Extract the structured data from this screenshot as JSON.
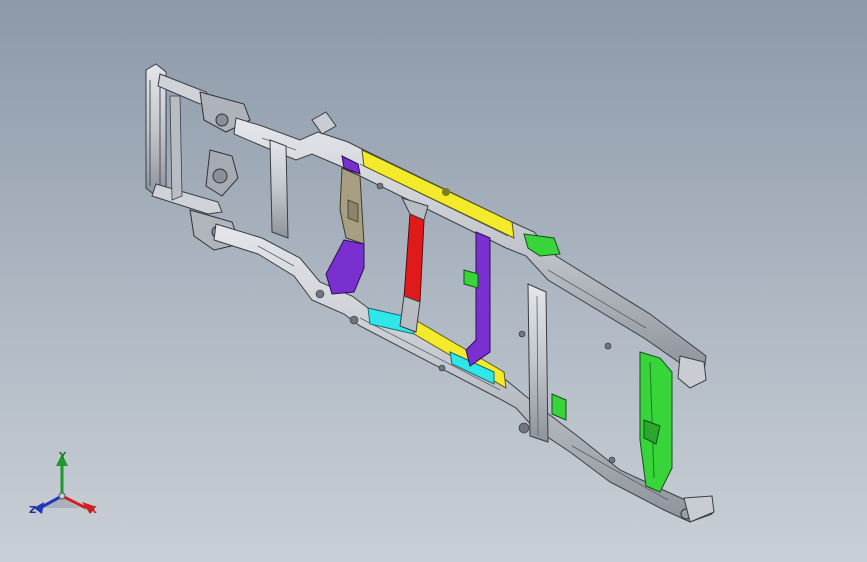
{
  "viewport": {
    "background_top": "#8d99a8",
    "background_bottom": "#c9cfd6"
  },
  "model": {
    "kind": "vehicle ladder frame chassis assembly",
    "colors": {
      "frame_steel": "#c2c5cc",
      "frame_edge": "#3a3d44",
      "crossmember_yellow": "#f2ea2a",
      "crossmember_purple": "#7a2fd0",
      "crossmember_red": "#e01a1a",
      "crossmember_cyan": "#2fe6ea",
      "bracket_green": "#37d43a",
      "bracket_khaki": "#a89f82"
    }
  },
  "triad": {
    "x_label": "X",
    "y_label": "Y",
    "z_label": "Z",
    "x_color": "#d21f1f",
    "y_color": "#1c9a2a",
    "z_color": "#2036b8"
  }
}
